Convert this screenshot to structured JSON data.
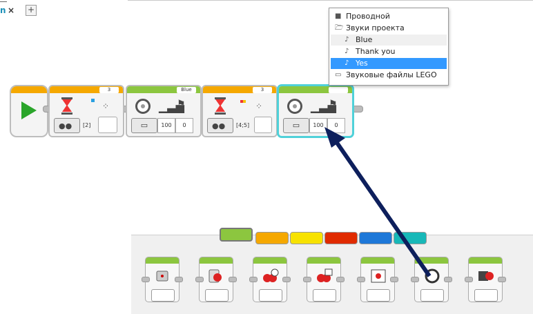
{
  "tab": {
    "label": "n",
    "close": "×",
    "add": "+"
  },
  "program": {
    "blocks": [
      {
        "type": "wait",
        "param": "3",
        "slot": "[2]"
      },
      {
        "type": "sound",
        "param": "Blue",
        "volume": "100",
        "play": "0"
      },
      {
        "type": "wait",
        "param": "3",
        "slot": "[4;5]"
      },
      {
        "type": "sound",
        "param": "",
        "volume": "100",
        "play": "0",
        "selected": true
      }
    ]
  },
  "popup": {
    "items": [
      {
        "label": "Проводной",
        "icon": "computer-icon"
      },
      {
        "label": "Звуки проекта",
        "icon": "open-folder-icon"
      },
      {
        "label": "Blue",
        "icon": "sound-file-icon"
      },
      {
        "label": "Thank you",
        "icon": "sound-file-icon"
      },
      {
        "label": "Yes",
        "icon": "sound-file-icon",
        "selected": true
      },
      {
        "label": "Звуковые файлы LEGO",
        "icon": "folder-icon"
      }
    ]
  },
  "palette": {
    "tab_colors": [
      "#8cc63f",
      "#f5a800",
      "#f7e200",
      "#e02b00",
      "#1e78d8",
      "#18b8b8"
    ],
    "blocks": [
      "medium-motor",
      "large-motor",
      "move-steering",
      "move-tank",
      "display",
      "sound",
      "brick-status-light"
    ]
  },
  "colors": {
    "accent": "#3399ff",
    "arrow": "#0d1f5c",
    "selection": "#4fd1d9"
  }
}
